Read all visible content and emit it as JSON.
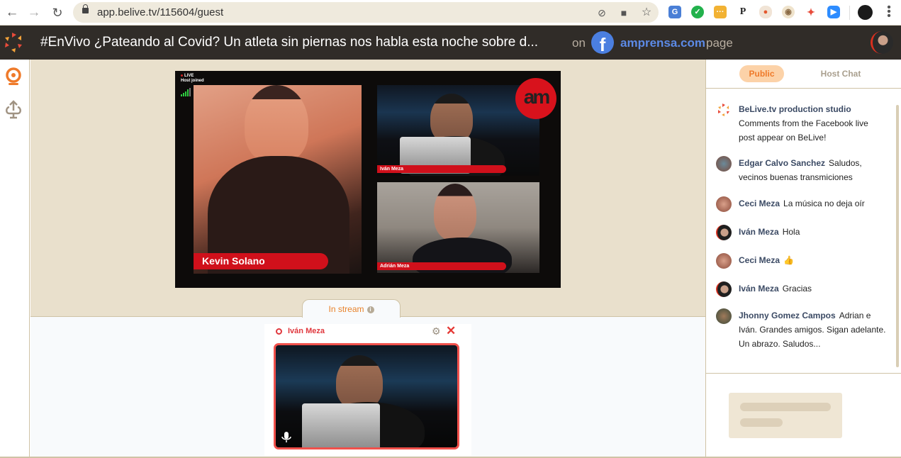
{
  "browser": {
    "url": "app.belive.tv/115604/guest",
    "back_label": "←",
    "forward_label": "→",
    "reload_label": "↻",
    "omnibox_icons": [
      "location-blocked-icon",
      "camera-icon",
      "bookmark-star-icon"
    ],
    "extensions": [
      {
        "name": "google-translate-extension",
        "glyph": "G",
        "color": "#4a7fd6"
      },
      {
        "name": "thumbs-up-extension",
        "glyph": "👍",
        "color": "#22b14c"
      },
      {
        "name": "dots-extension",
        "glyph": "···",
        "color": "#f2b233"
      },
      {
        "name": "p-extension",
        "glyph": "P",
        "color": "#ffffff"
      },
      {
        "name": "record-extension",
        "glyph": "●",
        "color": "#e4572e"
      },
      {
        "name": "coffee-extension",
        "glyph": "☕",
        "color": "#c9a77a"
      },
      {
        "name": "belive-extension",
        "glyph": "✦",
        "color": "#e84b3a"
      },
      {
        "name": "zoom-extension",
        "glyph": "■",
        "color": "#2d8cff"
      }
    ]
  },
  "header": {
    "title": "#EnVivo ¿Pateando al Covid? Un atleta sin piernas nos habla esta noche sobre d...",
    "on_label": "on",
    "page_name": "amprensa.com",
    "page_suffix": "page"
  },
  "stage": {
    "live_label": "LIVE",
    "status_label": "Host joined",
    "brand_logo": "am",
    "speakers": [
      {
        "name": "Kevin Solano"
      },
      {
        "name": "Iván Meza"
      },
      {
        "name": "Adrián Meza"
      }
    ]
  },
  "tray": {
    "tab_label": "In stream",
    "tab_info": "i",
    "guest_name": "Iván Meza",
    "settings_glyph": "⚙",
    "close_glyph": "✕"
  },
  "chat": {
    "tabs": [
      {
        "label": "Public",
        "active": true
      },
      {
        "label": "Host Chat",
        "active": false
      }
    ],
    "messages": [
      {
        "author": "BeLive.tv production studio",
        "text": "Comments from the Facebook live post appear on BeLive!"
      },
      {
        "author": "Edgar Calvo Sanchez",
        "text": "Saludos, vecinos buenas transmiciones"
      },
      {
        "author": "Ceci Meza",
        "text": "La música no deja oír"
      },
      {
        "author": "Iván Meza",
        "text": "Hola"
      },
      {
        "author": "Ceci Meza",
        "text": "👍"
      },
      {
        "author": "Iván Meza",
        "text": "Gracias"
      },
      {
        "author": "Jhonny Gomez Campos",
        "text": "Adrian e Iván. Grandes amigos. Sigan adelante. Un abrazo. Saludos..."
      }
    ]
  },
  "colors": {
    "accent_orange": "#ef7a2a",
    "header_bg": "#302c28",
    "facebook_blue": "#5c8ae6",
    "live_red": "#d0101b"
  }
}
